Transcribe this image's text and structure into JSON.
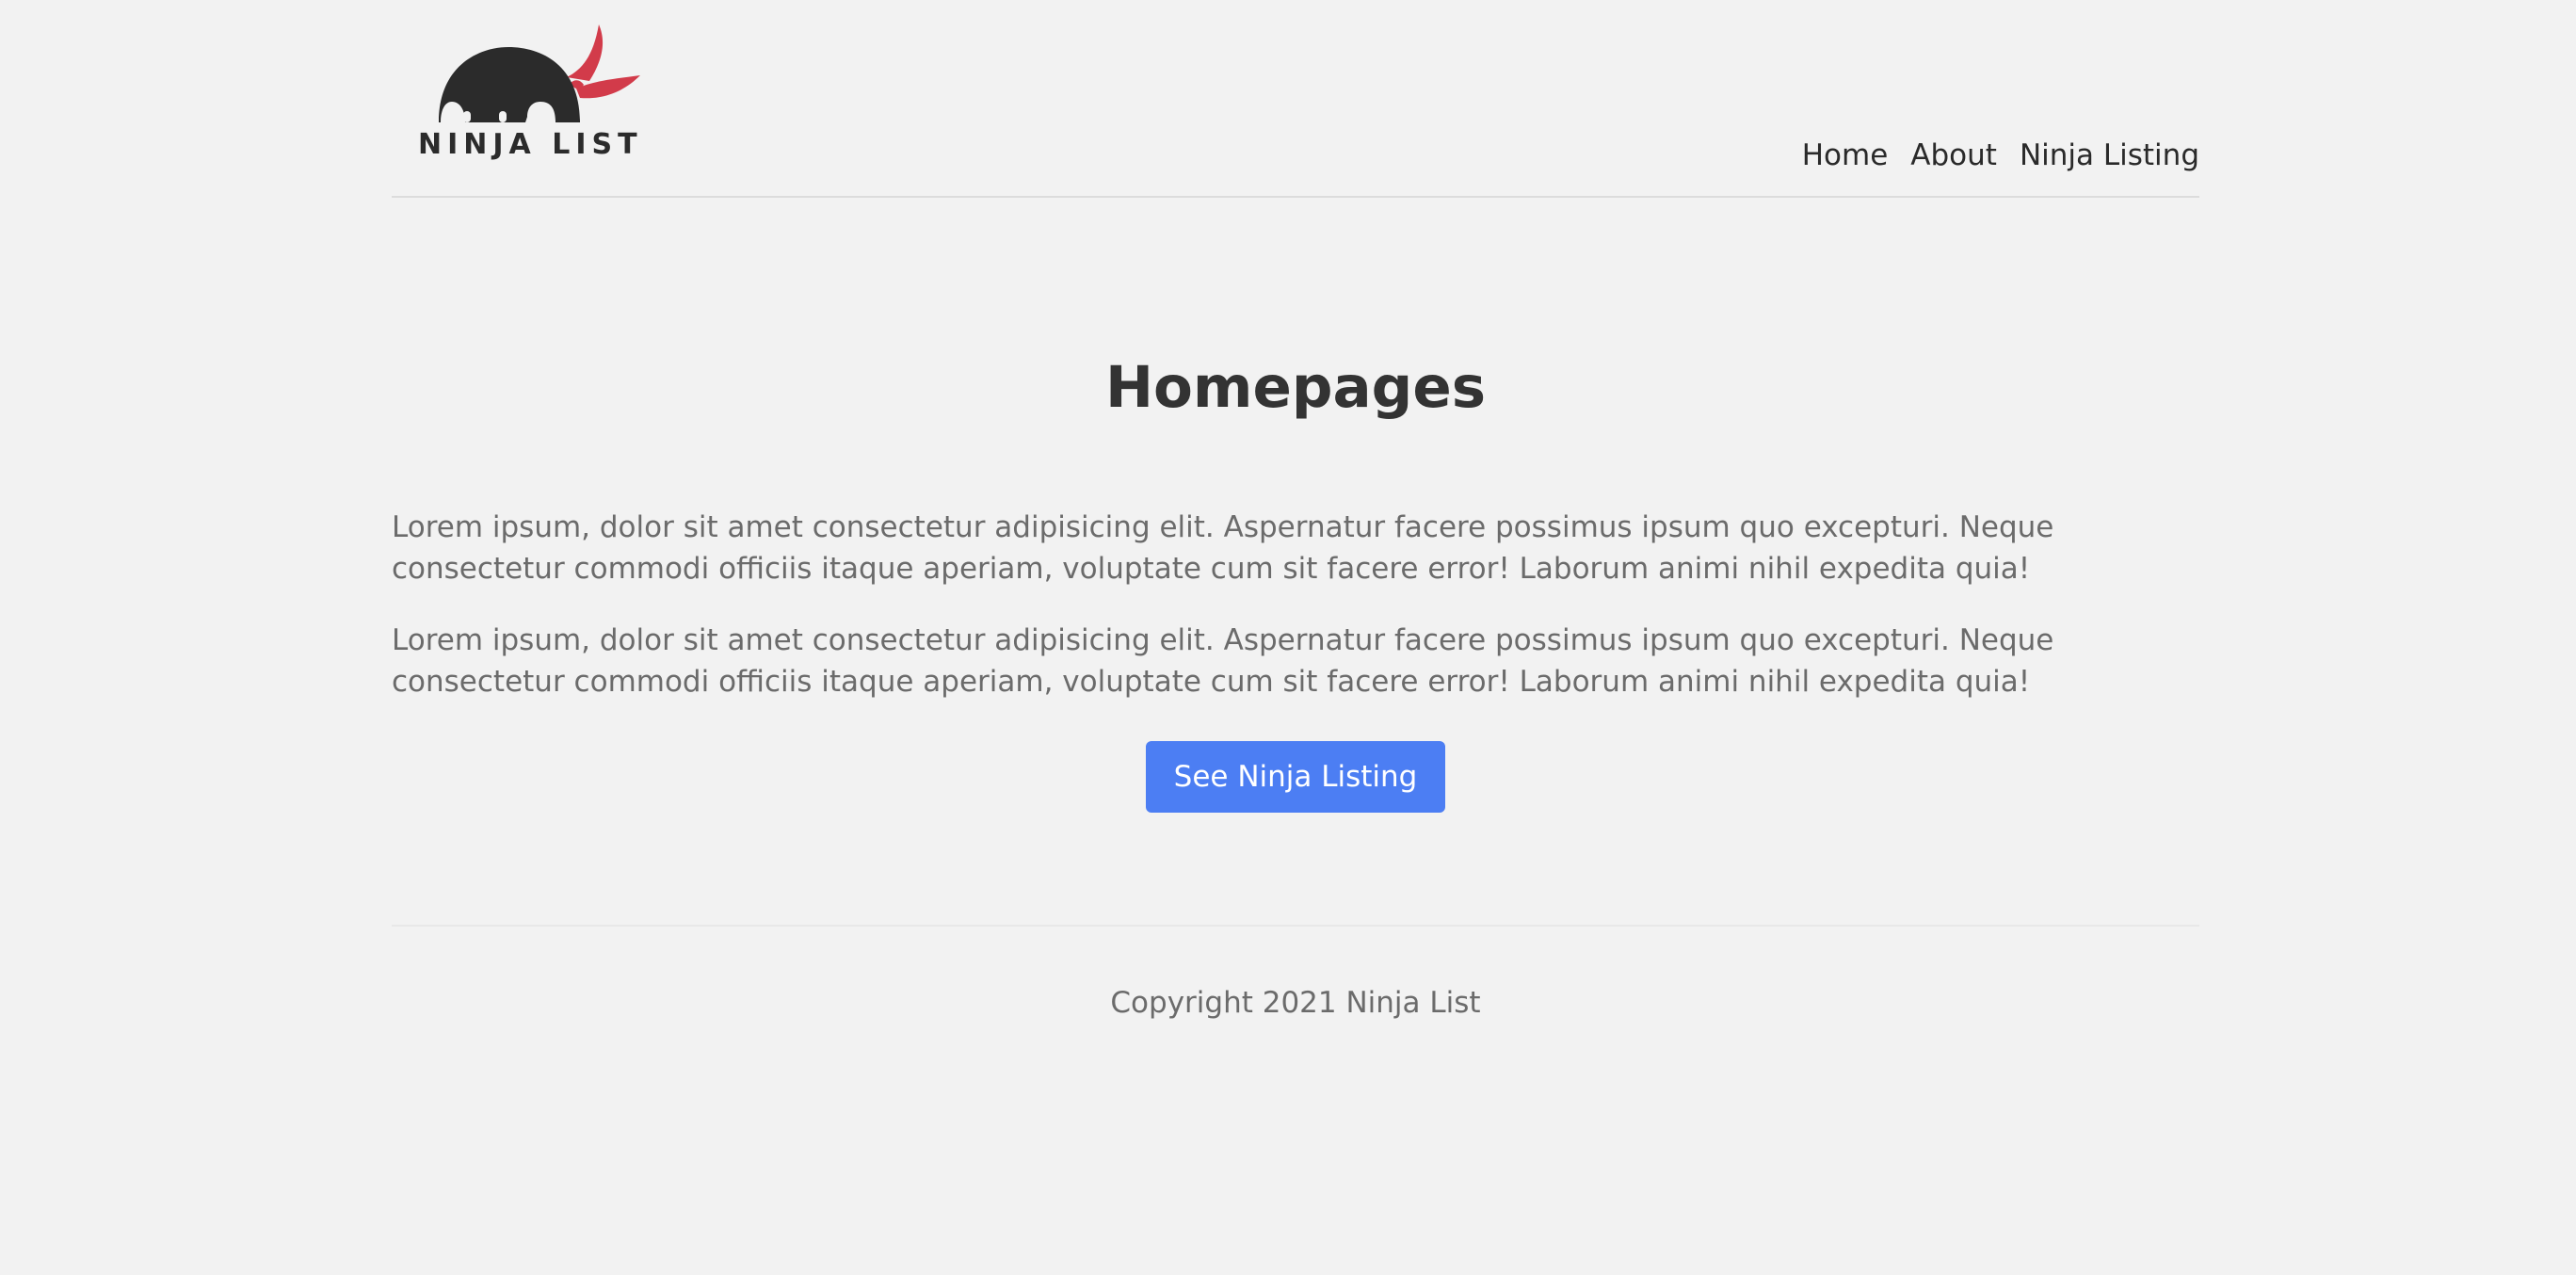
{
  "brand": {
    "logo_text": "NINJA LIST",
    "logo_icon": "ninja-head-icon",
    "colors": {
      "head": "#2b2b2b",
      "bandana": "#d23b4a"
    }
  },
  "nav": {
    "items": [
      {
        "label": "Home"
      },
      {
        "label": "About"
      },
      {
        "label": "Ninja Listing"
      }
    ]
  },
  "main": {
    "title": "Homepages",
    "paragraphs": [
      "Lorem ipsum, dolor sit amet consectetur adipisicing elit. Aspernatur facere possimus ipsum quo excepturi. Neque consectetur commodi officiis itaque aperiam, voluptate cum sit facere error! Laborum animi nihil expedita quia!",
      "Lorem ipsum, dolor sit amet consectetur adipisicing elit. Aspernatur facere possimus ipsum quo excepturi. Neque consectetur commodi officiis itaque aperiam, voluptate cum sit facere error! Laborum animi nihil expedita quia!"
    ],
    "cta_label": "See Ninja Listing",
    "cta_color": "#4c7ef3"
  },
  "footer": {
    "copyright": "Copyright 2021 Ninja List"
  }
}
